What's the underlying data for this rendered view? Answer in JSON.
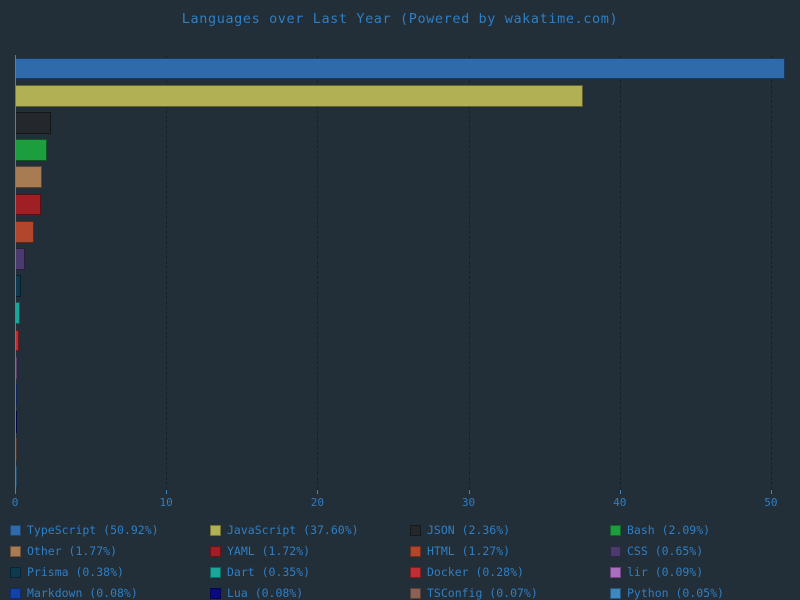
{
  "chart_data": {
    "type": "bar",
    "orientation": "horizontal",
    "title": "Languages over Last Year (Powered by wakatime.com)",
    "xlabel": "",
    "ylabel": "",
    "xlim": [
      0,
      51
    ],
    "xticks": [
      "0",
      "10",
      "20",
      "30",
      "40",
      "50"
    ],
    "xtick_values": [
      0,
      10,
      20,
      30,
      40,
      50
    ],
    "grid": true,
    "legend_position": "bottom",
    "categories": [
      "TypeScript",
      "JavaScript",
      "JSON",
      "Bash",
      "Other",
      "YAML",
      "HTML",
      "CSS",
      "Prisma",
      "Dart",
      "Docker",
      "lir",
      "Markdown",
      "Lua",
      "TSConfig",
      "Python"
    ],
    "values": [
      50.92,
      37.6,
      2.36,
      2.09,
      1.77,
      1.72,
      1.27,
      0.65,
      0.38,
      0.35,
      0.28,
      0.09,
      0.08,
      0.08,
      0.07,
      0.05
    ],
    "unit": "%",
    "colors": [
      "#2f6bab",
      "#b2b054",
      "#24282c",
      "#1c9e3e",
      "#a87c52",
      "#a01f24",
      "#b2462a",
      "#4a3a6e",
      "#0e3a4f",
      "#17a79b",
      "#c02e34",
      "#a96ec0",
      "#1442a8",
      "#0a0a80",
      "#8a6155",
      "#3d88bf"
    ]
  },
  "legend": {
    "entries": [
      {
        "label": "TypeScript (50.92%)",
        "color": "#2f6bab"
      },
      {
        "label": "JavaScript (37.60%)",
        "color": "#b2b054"
      },
      {
        "label": "JSON (2.36%)",
        "color": "#24282c"
      },
      {
        "label": "Bash (2.09%)",
        "color": "#1c9e3e"
      },
      {
        "label": "Other (1.77%)",
        "color": "#a87c52"
      },
      {
        "label": "YAML (1.72%)",
        "color": "#a01f24"
      },
      {
        "label": "HTML (1.27%)",
        "color": "#b2462a"
      },
      {
        "label": "CSS (0.65%)",
        "color": "#4a3a6e"
      },
      {
        "label": "Prisma (0.38%)",
        "color": "#0e3a4f"
      },
      {
        "label": "Dart (0.35%)",
        "color": "#17a79b"
      },
      {
        "label": "Docker (0.28%)",
        "color": "#c02e34"
      },
      {
        "label": "lir (0.09%)",
        "color": "#a96ec0"
      },
      {
        "label": "Markdown (0.08%)",
        "color": "#1442a8"
      },
      {
        "label": "Lua (0.08%)",
        "color": "#0a0a80"
      },
      {
        "label": "TSConfig (0.07%)",
        "color": "#8a6155"
      },
      {
        "label": "Python (0.05%)",
        "color": "#3d88bf"
      }
    ]
  },
  "theme": {
    "background": "#222e38",
    "text_color": "#2f7fc4",
    "axis_color": "#3d88bf",
    "grid_color": "#16202a"
  }
}
